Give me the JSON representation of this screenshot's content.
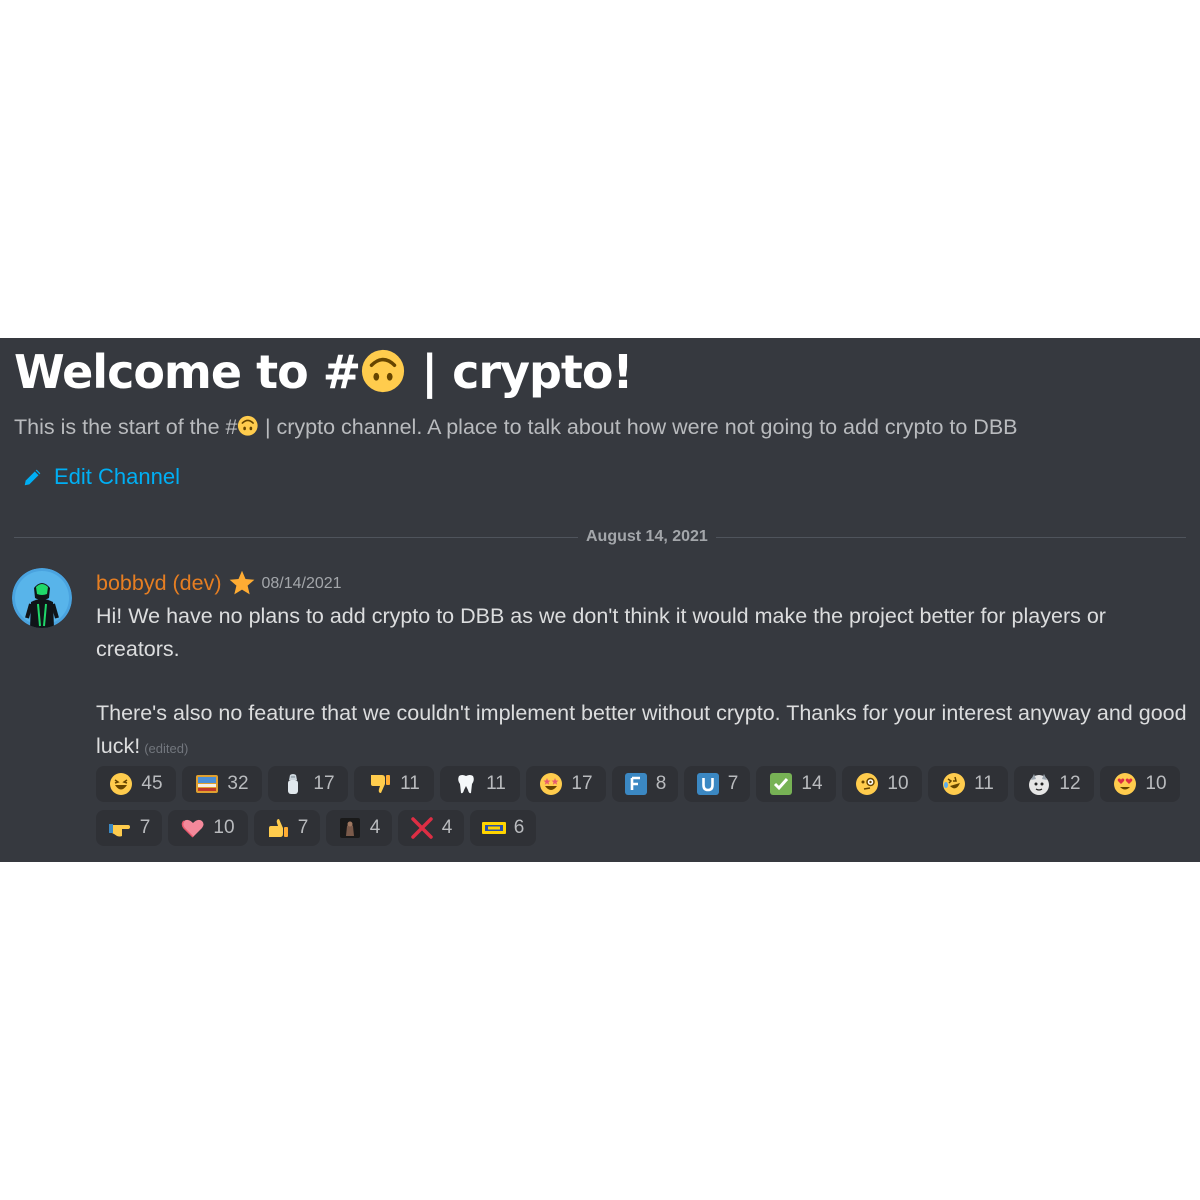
{
  "channel": {
    "welcome_prefix": "Welcome to #",
    "welcome_suffix": " | crypto!",
    "channel_emoji": "upside-down-face-emoji",
    "description_prefix": "This is the start of the #",
    "description_suffix": " | crypto channel. A place to talk about how were not going to add crypto to DBB",
    "edit_label": "Edit Channel"
  },
  "divider": {
    "date": "August 14, 2021"
  },
  "message": {
    "username": "bobbyd (dev)",
    "badge": "star-icon",
    "timestamp": "08/14/2021",
    "paragraph1": "Hi! We have no plans to add crypto to DBB as we don't think it would make the project better for players or creators.",
    "paragraph2": "There's also no feature that we couldn't implement better without crypto. Thanks for your interest anyway and good luck!",
    "edited": "(edited)"
  },
  "reactions": [
    {
      "icon": "laughing-face-icon",
      "count": "45"
    },
    {
      "icon": "custom-scene-icon",
      "count": "32"
    },
    {
      "icon": "salt-shaker-icon",
      "count": "17"
    },
    {
      "icon": "thumbs-down-icon",
      "count": "11"
    },
    {
      "icon": "tooth-icon",
      "count": "11"
    },
    {
      "icon": "star-struck-icon",
      "count": "17"
    },
    {
      "icon": "letter-f-icon",
      "count": "8"
    },
    {
      "icon": "letter-u-icon",
      "count": "7"
    },
    {
      "icon": "check-mark-icon",
      "count": "14"
    },
    {
      "icon": "monocle-face-icon",
      "count": "10"
    },
    {
      "icon": "rofl-face-icon",
      "count": "11"
    },
    {
      "icon": "custom-creature-icon",
      "count": "12"
    },
    {
      "icon": "heart-eyes-icon",
      "count": "10"
    },
    {
      "icon": "pointing-right-icon",
      "count": "7"
    },
    {
      "icon": "heart-icon",
      "count": "10"
    },
    {
      "icon": "thumbs-up-icon",
      "count": "7"
    },
    {
      "icon": "custom-dark-icon",
      "count": "4"
    },
    {
      "icon": "cross-mark-icon",
      "count": "4"
    },
    {
      "icon": "custom-peeps-icon",
      "count": "6"
    }
  ],
  "colors": {
    "background": "#36393f",
    "title": "#ffffff",
    "link": "#00aff4",
    "username": "#e67e22",
    "body_text": "#dcddde",
    "muted": "#a3a6aa",
    "reaction_bg": "#2f3136"
  }
}
